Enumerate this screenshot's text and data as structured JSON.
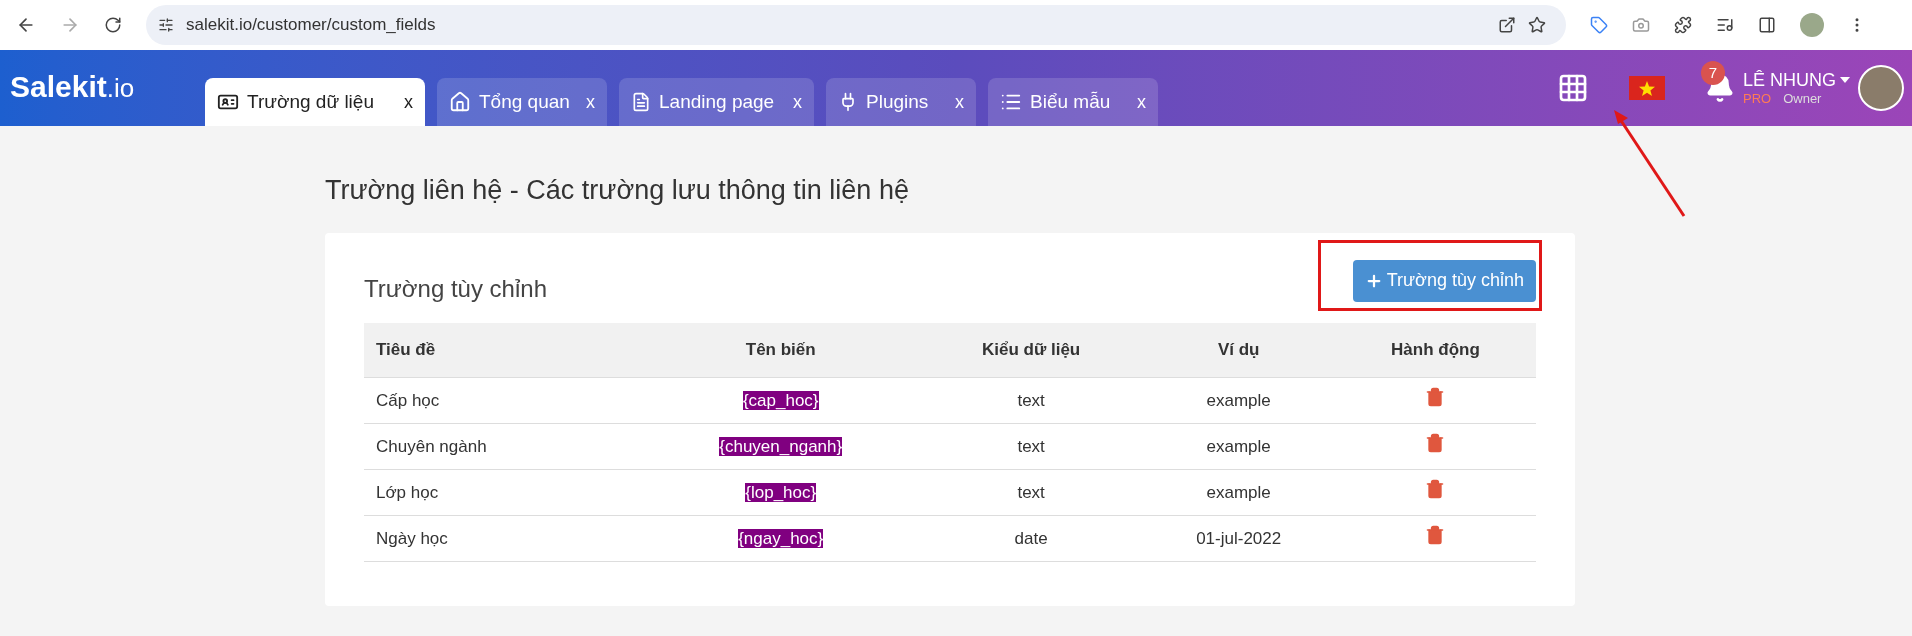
{
  "browser": {
    "url": "salekit.io/customer/custom_fields"
  },
  "header": {
    "logo": {
      "main": "Salekit",
      "suffix": ".io"
    },
    "tabs": [
      {
        "label": "Trường dữ liệu",
        "kind": "card",
        "close": "x",
        "selected": true
      },
      {
        "label": "Tổng quan",
        "kind": "home",
        "close": "x",
        "selected": false
      },
      {
        "label": "Landing page",
        "kind": "file",
        "close": "x",
        "selected": false
      },
      {
        "label": "Plugins",
        "kind": "plug",
        "close": "x",
        "selected": false
      },
      {
        "label": "Biểu mẫu",
        "kind": "list",
        "close": "x",
        "selected": false
      }
    ],
    "notifications": "7",
    "user": {
      "name": "LÊ NHUNG",
      "plan": "PRO",
      "role": "Owner"
    }
  },
  "page": {
    "title": "Trường liên hệ - Các trường lưu thông tin liên hệ",
    "card": {
      "title": "Trường tùy chỉnh",
      "add_button": "Trường tùy chỉnh",
      "table": {
        "columns": [
          "Tiêu đề",
          "Tên biến",
          "Kiểu dữ liệu",
          "Ví dụ",
          "Hành động"
        ],
        "rows": [
          {
            "title": "Cấp học",
            "variable": "{cap_hoc}",
            "type": "text",
            "example": "example"
          },
          {
            "title": "Chuyên ngành",
            "variable": "{chuyen_nganh}",
            "type": "text",
            "example": "example"
          },
          {
            "title": "Lớp học",
            "variable": "{lop_hoc}",
            "type": "text",
            "example": "example"
          },
          {
            "title": "Ngày học",
            "variable": "{ngay_hoc}",
            "type": "date",
            "example": "01-jul-2022"
          }
        ]
      }
    }
  }
}
